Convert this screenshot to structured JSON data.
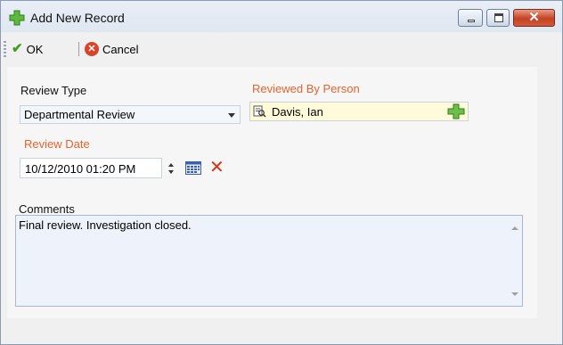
{
  "window": {
    "title": "Add New Record",
    "minimize_icon": "minimize-icon",
    "maximize_icon": "maximize-icon",
    "close_icon": "close-icon",
    "close_glyph": "✕"
  },
  "toolbar": {
    "ok_label": "OK",
    "cancel_label": "Cancel",
    "ok_icon": "check-icon",
    "cancel_icon": "cancel-icon",
    "cancel_glyph": "✕"
  },
  "form": {
    "review_type": {
      "label": "Review Type",
      "value": "Departmental Review"
    },
    "reviewed_by": {
      "label": "Reviewed By Person",
      "value": "Davis, Ian",
      "required": true
    },
    "review_date": {
      "label": "Review Date",
      "value": "10/12/2010 01:20 PM",
      "required": true
    },
    "comments": {
      "label": "Comments",
      "value": "Final review. Investigation closed."
    }
  },
  "colors": {
    "required_label": "#e8622c",
    "person_field_bg": "#fffbd8",
    "close_button": "#c44222",
    "ok_check": "#3aa01e"
  }
}
